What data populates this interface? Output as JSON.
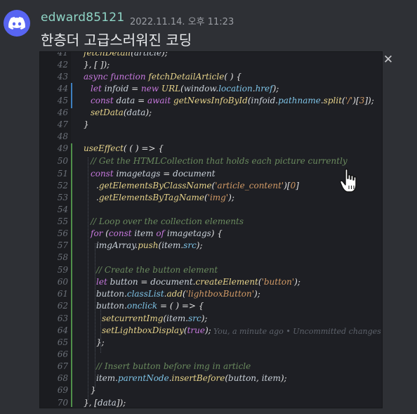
{
  "header": {
    "username": "edward85121",
    "timestamp": "2022.11.14. 오후 11:23",
    "message": "한층더 고급스러워진 코딩"
  },
  "icons": {
    "avatar": "discord-logo",
    "close": "close-icon",
    "cursor": "hand-pointer-icon"
  },
  "close_glyph": "✕",
  "editor": {
    "line_numbers": [
      "41",
      "42",
      "43",
      "44",
      "45",
      "46",
      "47",
      "48",
      "49",
      "50",
      "51",
      "52",
      "53",
      "54",
      "55",
      "56",
      "57",
      "58",
      "59",
      "60",
      "61",
      "62",
      "63",
      "64",
      "65",
      "66",
      "67",
      "68",
      "69",
      "70"
    ],
    "blame": "You, a minute ago • Uncommitted changes"
  }
}
